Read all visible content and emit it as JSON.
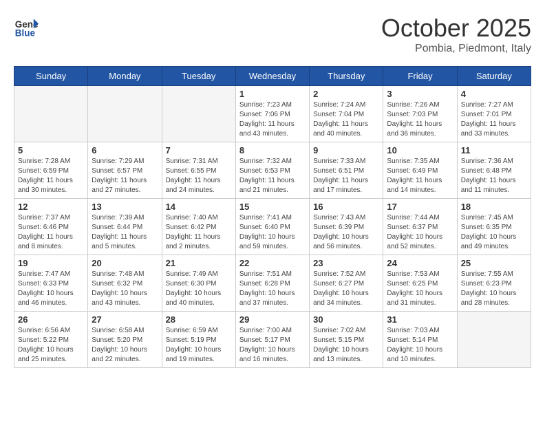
{
  "header": {
    "logo_line1": "General",
    "logo_line2": "Blue",
    "month": "October 2025",
    "location": "Pombia, Piedmont, Italy"
  },
  "weekdays": [
    "Sunday",
    "Monday",
    "Tuesday",
    "Wednesday",
    "Thursday",
    "Friday",
    "Saturday"
  ],
  "weeks": [
    [
      {
        "day": "",
        "info": ""
      },
      {
        "day": "",
        "info": ""
      },
      {
        "day": "",
        "info": ""
      },
      {
        "day": "1",
        "info": "Sunrise: 7:23 AM\nSunset: 7:06 PM\nDaylight: 11 hours and 43 minutes."
      },
      {
        "day": "2",
        "info": "Sunrise: 7:24 AM\nSunset: 7:04 PM\nDaylight: 11 hours and 40 minutes."
      },
      {
        "day": "3",
        "info": "Sunrise: 7:26 AM\nSunset: 7:03 PM\nDaylight: 11 hours and 36 minutes."
      },
      {
        "day": "4",
        "info": "Sunrise: 7:27 AM\nSunset: 7:01 PM\nDaylight: 11 hours and 33 minutes."
      }
    ],
    [
      {
        "day": "5",
        "info": "Sunrise: 7:28 AM\nSunset: 6:59 PM\nDaylight: 11 hours and 30 minutes."
      },
      {
        "day": "6",
        "info": "Sunrise: 7:29 AM\nSunset: 6:57 PM\nDaylight: 11 hours and 27 minutes."
      },
      {
        "day": "7",
        "info": "Sunrise: 7:31 AM\nSunset: 6:55 PM\nDaylight: 11 hours and 24 minutes."
      },
      {
        "day": "8",
        "info": "Sunrise: 7:32 AM\nSunset: 6:53 PM\nDaylight: 11 hours and 21 minutes."
      },
      {
        "day": "9",
        "info": "Sunrise: 7:33 AM\nSunset: 6:51 PM\nDaylight: 11 hours and 17 minutes."
      },
      {
        "day": "10",
        "info": "Sunrise: 7:35 AM\nSunset: 6:49 PM\nDaylight: 11 hours and 14 minutes."
      },
      {
        "day": "11",
        "info": "Sunrise: 7:36 AM\nSunset: 6:48 PM\nDaylight: 11 hours and 11 minutes."
      }
    ],
    [
      {
        "day": "12",
        "info": "Sunrise: 7:37 AM\nSunset: 6:46 PM\nDaylight: 11 hours and 8 minutes."
      },
      {
        "day": "13",
        "info": "Sunrise: 7:39 AM\nSunset: 6:44 PM\nDaylight: 11 hours and 5 minutes."
      },
      {
        "day": "14",
        "info": "Sunrise: 7:40 AM\nSunset: 6:42 PM\nDaylight: 11 hours and 2 minutes."
      },
      {
        "day": "15",
        "info": "Sunrise: 7:41 AM\nSunset: 6:40 PM\nDaylight: 10 hours and 59 minutes."
      },
      {
        "day": "16",
        "info": "Sunrise: 7:43 AM\nSunset: 6:39 PM\nDaylight: 10 hours and 56 minutes."
      },
      {
        "day": "17",
        "info": "Sunrise: 7:44 AM\nSunset: 6:37 PM\nDaylight: 10 hours and 52 minutes."
      },
      {
        "day": "18",
        "info": "Sunrise: 7:45 AM\nSunset: 6:35 PM\nDaylight: 10 hours and 49 minutes."
      }
    ],
    [
      {
        "day": "19",
        "info": "Sunrise: 7:47 AM\nSunset: 6:33 PM\nDaylight: 10 hours and 46 minutes."
      },
      {
        "day": "20",
        "info": "Sunrise: 7:48 AM\nSunset: 6:32 PM\nDaylight: 10 hours and 43 minutes."
      },
      {
        "day": "21",
        "info": "Sunrise: 7:49 AM\nSunset: 6:30 PM\nDaylight: 10 hours and 40 minutes."
      },
      {
        "day": "22",
        "info": "Sunrise: 7:51 AM\nSunset: 6:28 PM\nDaylight: 10 hours and 37 minutes."
      },
      {
        "day": "23",
        "info": "Sunrise: 7:52 AM\nSunset: 6:27 PM\nDaylight: 10 hours and 34 minutes."
      },
      {
        "day": "24",
        "info": "Sunrise: 7:53 AM\nSunset: 6:25 PM\nDaylight: 10 hours and 31 minutes."
      },
      {
        "day": "25",
        "info": "Sunrise: 7:55 AM\nSunset: 6:23 PM\nDaylight: 10 hours and 28 minutes."
      }
    ],
    [
      {
        "day": "26",
        "info": "Sunrise: 6:56 AM\nSunset: 5:22 PM\nDaylight: 10 hours and 25 minutes."
      },
      {
        "day": "27",
        "info": "Sunrise: 6:58 AM\nSunset: 5:20 PM\nDaylight: 10 hours and 22 minutes."
      },
      {
        "day": "28",
        "info": "Sunrise: 6:59 AM\nSunset: 5:19 PM\nDaylight: 10 hours and 19 minutes."
      },
      {
        "day": "29",
        "info": "Sunrise: 7:00 AM\nSunset: 5:17 PM\nDaylight: 10 hours and 16 minutes."
      },
      {
        "day": "30",
        "info": "Sunrise: 7:02 AM\nSunset: 5:15 PM\nDaylight: 10 hours and 13 minutes."
      },
      {
        "day": "31",
        "info": "Sunrise: 7:03 AM\nSunset: 5:14 PM\nDaylight: 10 hours and 10 minutes."
      },
      {
        "day": "",
        "info": ""
      }
    ]
  ]
}
